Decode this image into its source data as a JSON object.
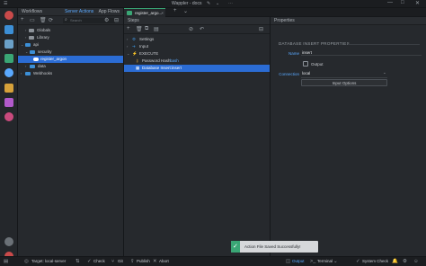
{
  "window": {
    "title": "Wappler - docs",
    "minimize": "—",
    "maximize": "□",
    "close": "✕"
  },
  "workflows": {
    "header": "Workflows",
    "tabs": [
      "Server Actions",
      "App Flows"
    ],
    "search_placeholder": "Search",
    "tree": [
      {
        "label": "Globals",
        "depth": 1,
        "expanded": false,
        "selected": false
      },
      {
        "label": "Library",
        "depth": 1,
        "expanded": false,
        "selected": false
      },
      {
        "label": "api",
        "depth": 0,
        "expanded": true,
        "selected": false
      },
      {
        "label": "security",
        "depth": 1,
        "expanded": true,
        "selected": false
      },
      {
        "label": "register_argon",
        "depth": 2,
        "expanded": false,
        "selected": true
      },
      {
        "label": "data",
        "depth": 1,
        "expanded": false,
        "selected": false
      },
      {
        "label": "Webhooks",
        "depth": 0,
        "expanded": false,
        "selected": false
      }
    ]
  },
  "document_tab": {
    "label": "register_argo..."
  },
  "steps": {
    "header": "Steps",
    "items": [
      {
        "label": "Settings",
        "selected": false
      },
      {
        "label": "Input",
        "selected": false
      },
      {
        "label": "EXECUTE",
        "selected": false
      },
      {
        "label": "Password Hash:",
        "value": "hash",
        "selected": false
      },
      {
        "label": "Database Insert:",
        "value": "insert",
        "selected": true
      }
    ]
  },
  "properties": {
    "header": "Properties",
    "section_title": "DATABASE INSERT PROPERTIES",
    "name_label": "Name",
    "name_value": "insert",
    "output_label": "Output",
    "connection_label": "Connection",
    "connection_value": "local",
    "input_options_button": "Input Options"
  },
  "toast": {
    "message": "Action File Saved Successfully!"
  },
  "statusbar": {
    "target": "Target: local-server",
    "check": "Check",
    "git": "Git",
    "publish": "Publish",
    "abort": "Abort",
    "output": "Output",
    "terminal": "Terminal",
    "system_check": "System Check"
  },
  "colors": {
    "accent": "#5aa9ff",
    "selection": "#2b6cd4",
    "success": "#3aa675"
  }
}
